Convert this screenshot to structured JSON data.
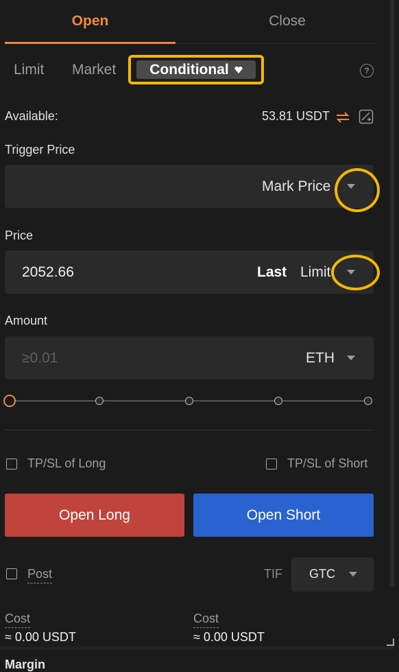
{
  "tabs": {
    "open": "Open",
    "close": "Close"
  },
  "order_types": {
    "limit": "Limit",
    "market": "Market",
    "conditional": "Conditional"
  },
  "available": {
    "label": "Available:",
    "value": "53.81 USDT"
  },
  "trigger": {
    "label": "Trigger Price",
    "type": "Mark Price"
  },
  "price": {
    "label": "Price",
    "value": "2052.66",
    "last": "Last",
    "limit": "Limit"
  },
  "amount": {
    "label": "Amount",
    "placeholder": "≥0.01",
    "unit": "ETH"
  },
  "slider": {
    "level": 0
  },
  "tpsl": {
    "long": "TP/SL of Long",
    "short": "TP/SL of Short"
  },
  "actions": {
    "open_long": "Open Long",
    "open_short": "Open Short"
  },
  "post": {
    "label": "Post",
    "tif_label": "TIF",
    "tif_value": "GTC"
  },
  "cost": [
    {
      "label": "Cost",
      "value": "≈ 0.00 USDT"
    },
    {
      "label": "Cost",
      "value": "≈ 0.00 USDT"
    }
  ],
  "margin": {
    "label": "Margin"
  },
  "colors": {
    "accent": "#f0883e",
    "highlight": "#f5b800",
    "long": "#c0443c",
    "short": "#2a62d0"
  }
}
